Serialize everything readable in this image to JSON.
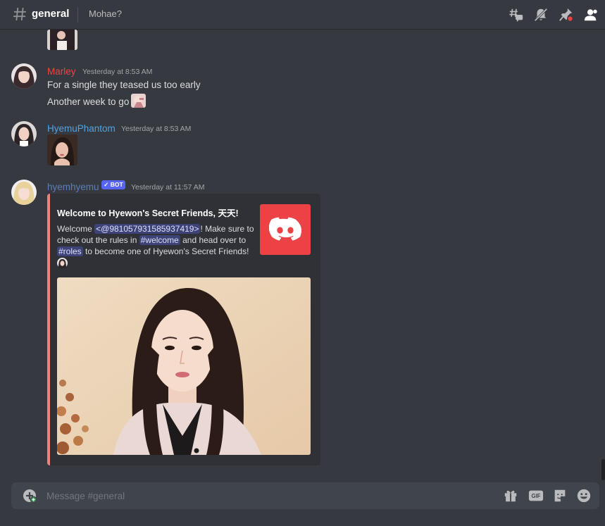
{
  "header": {
    "channel_name": "general",
    "topic": "Mohae?",
    "icons": [
      "threads-icon",
      "notifications-muted-icon",
      "pinned-messages-icon",
      "member-list-icon"
    ]
  },
  "messages": [
    {
      "author": "Marley",
      "author_color": "#ed4245",
      "timestamp": "Yesterday at 8:53 AM",
      "lines": [
        "For a single they teased us too early",
        "Another week to go"
      ]
    },
    {
      "author": "HyemuPhantom",
      "author_color": "#4fa3e6",
      "timestamp": "Yesterday at 8:53 AM"
    },
    {
      "author": "hyemhyemu",
      "author_color": "#5b7eb5",
      "timestamp": "Yesterday at 11:57 AM",
      "bot_tag": "✓ BOT",
      "embed": {
        "accent_color": "#e9857e",
        "title": "Welcome to Hyewon's Secret Friends, 天天!",
        "desc_1": "Welcome ",
        "mention_user": "<@981057931585937419>",
        "desc_2": "! Make sure to check out the rules in ",
        "mention_channel_1": "#welcome",
        "desc_3": " and head over to ",
        "mention_channel_2": "#roles",
        "desc_4": " to become one of Hyewon's Secret Friends!"
      }
    }
  ],
  "composer": {
    "placeholder": "Message #general",
    "icons": [
      "add-attachment-icon",
      "gift-icon",
      "gif-icon",
      "sticker-icon",
      "emoji-icon"
    ],
    "gif_label": "GIF"
  }
}
